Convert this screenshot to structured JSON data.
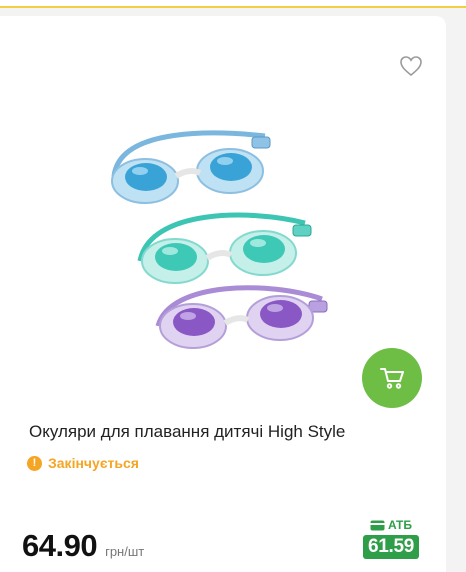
{
  "product": {
    "title": "Окуляри для плавання дитячі High Style",
    "status": "Закінчується",
    "price": "64.90",
    "unit": "грн/шт",
    "club_label": "АТБ",
    "club_price": "61.59"
  },
  "icons": {
    "favorite": "heart-outline-icon",
    "cart": "cart-icon",
    "status": "exclamation-circle-icon",
    "club": "card-icon"
  },
  "colors": {
    "accent_green": "#6ebe45",
    "club_green": "#2e9e48",
    "status_orange": "#f5a524",
    "top_border": "#f2cf3f"
  }
}
